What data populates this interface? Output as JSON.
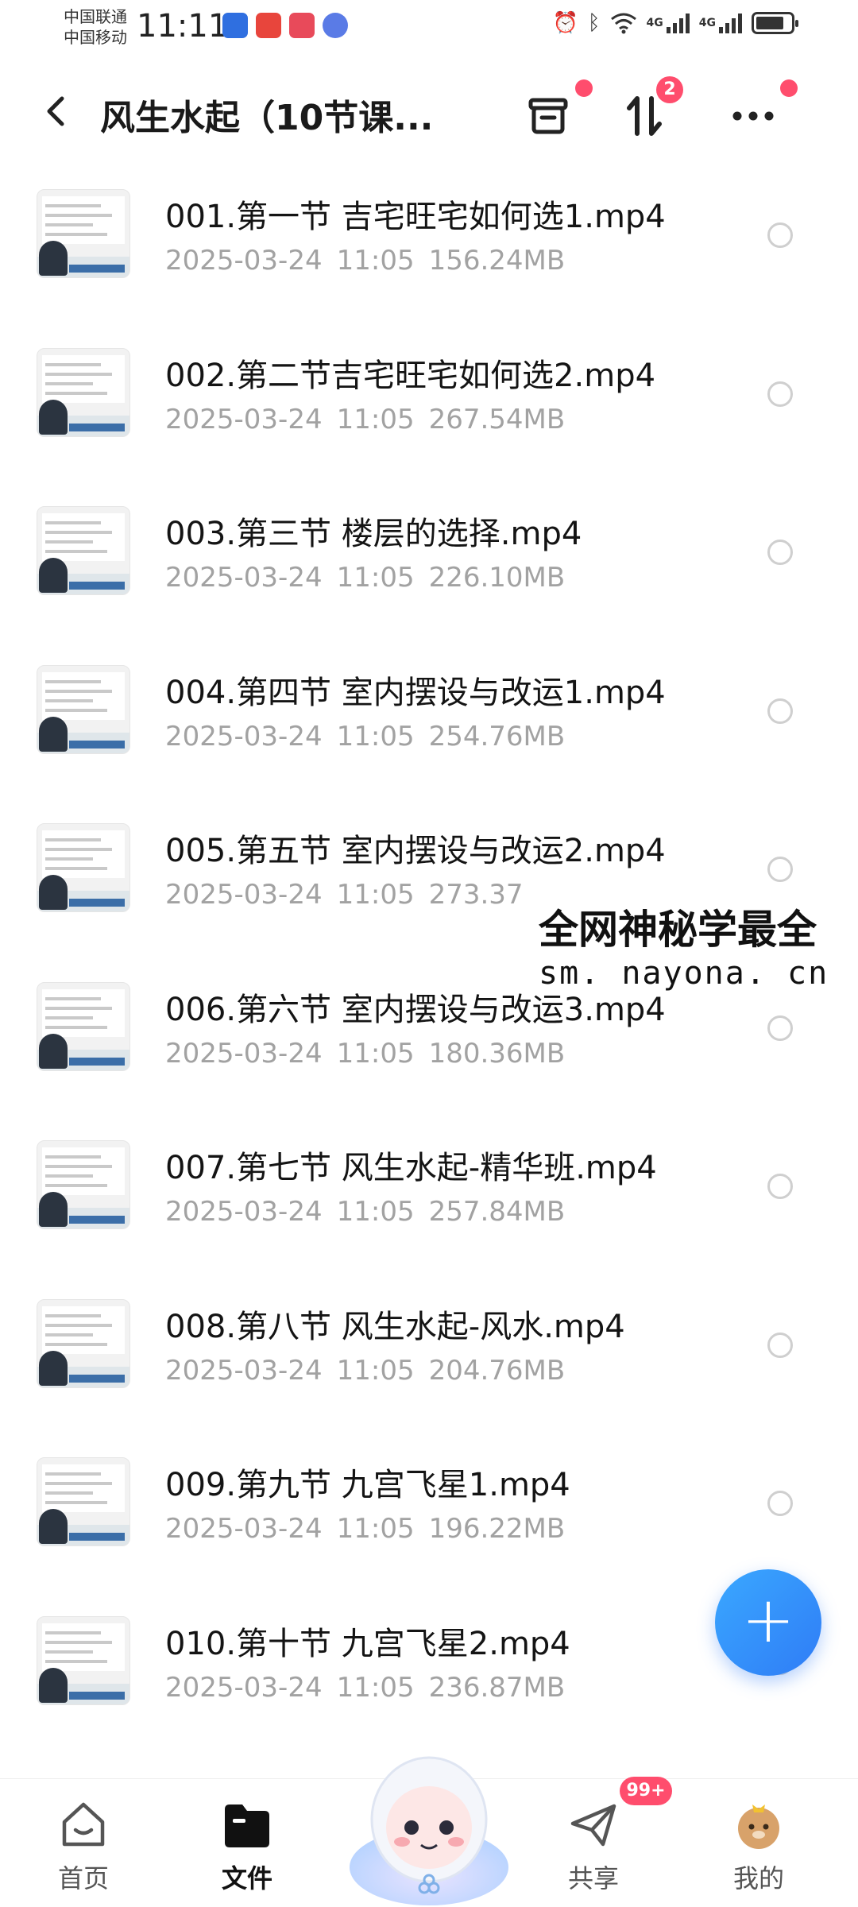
{
  "status_bar": {
    "carrier_1": "中国联通",
    "carrier_2": "中国移动",
    "time": "11:11",
    "network_1": "4G",
    "network_2": "4G"
  },
  "header": {
    "title": "风生水起（10节课...",
    "sort_badge": "2"
  },
  "files": [
    {
      "name": "001.第一节 吉宅旺宅如何选1.mp4",
      "date": "2025-03-24",
      "time": "11:05",
      "size": "156.24MB"
    },
    {
      "name": "002.第二节吉宅旺宅如何选2.mp4",
      "date": "2025-03-24",
      "time": "11:05",
      "size": "267.54MB"
    },
    {
      "name": "003.第三节 楼层的选择.mp4",
      "date": "2025-03-24",
      "time": "11:05",
      "size": "226.10MB"
    },
    {
      "name": "004.第四节 室内摆设与改运1.mp4",
      "date": "2025-03-24",
      "time": "11:05",
      "size": "254.76MB"
    },
    {
      "name": "005.第五节 室内摆设与改运2.mp4",
      "date": "2025-03-24",
      "time": "11:05",
      "size": "273.37"
    },
    {
      "name": "006.第六节 室内摆设与改运3.mp4",
      "date": "2025-03-24",
      "time": "11:05",
      "size": "180.36MB"
    },
    {
      "name": "007.第七节 风生水起-精华班.mp4",
      "date": "2025-03-24",
      "time": "11:05",
      "size": "257.84MB"
    },
    {
      "name": "008.第八节 风生水起-风水.mp4",
      "date": "2025-03-24",
      "time": "11:05",
      "size": "204.76MB"
    },
    {
      "name": "009.第九节 九宫飞星1.mp4",
      "date": "2025-03-24",
      "time": "11:05",
      "size": "196.22MB"
    },
    {
      "name": "010.第十节 九宫飞星2.mp4",
      "date": "2025-03-24",
      "time": "11:05",
      "size": "236.87MB"
    }
  ],
  "watermark": {
    "line1": "全网神秘学最全",
    "line2": "sm. nayona. cn"
  },
  "fab": {
    "label": "+"
  },
  "bottom_nav": {
    "home": "首页",
    "files": "文件",
    "share": "共享",
    "share_badge": "99+",
    "mine": "我的"
  },
  "colors": {
    "accent": "#2f7cf6",
    "badge": "#ff4d6d",
    "meta_text": "#a2a2a2"
  }
}
